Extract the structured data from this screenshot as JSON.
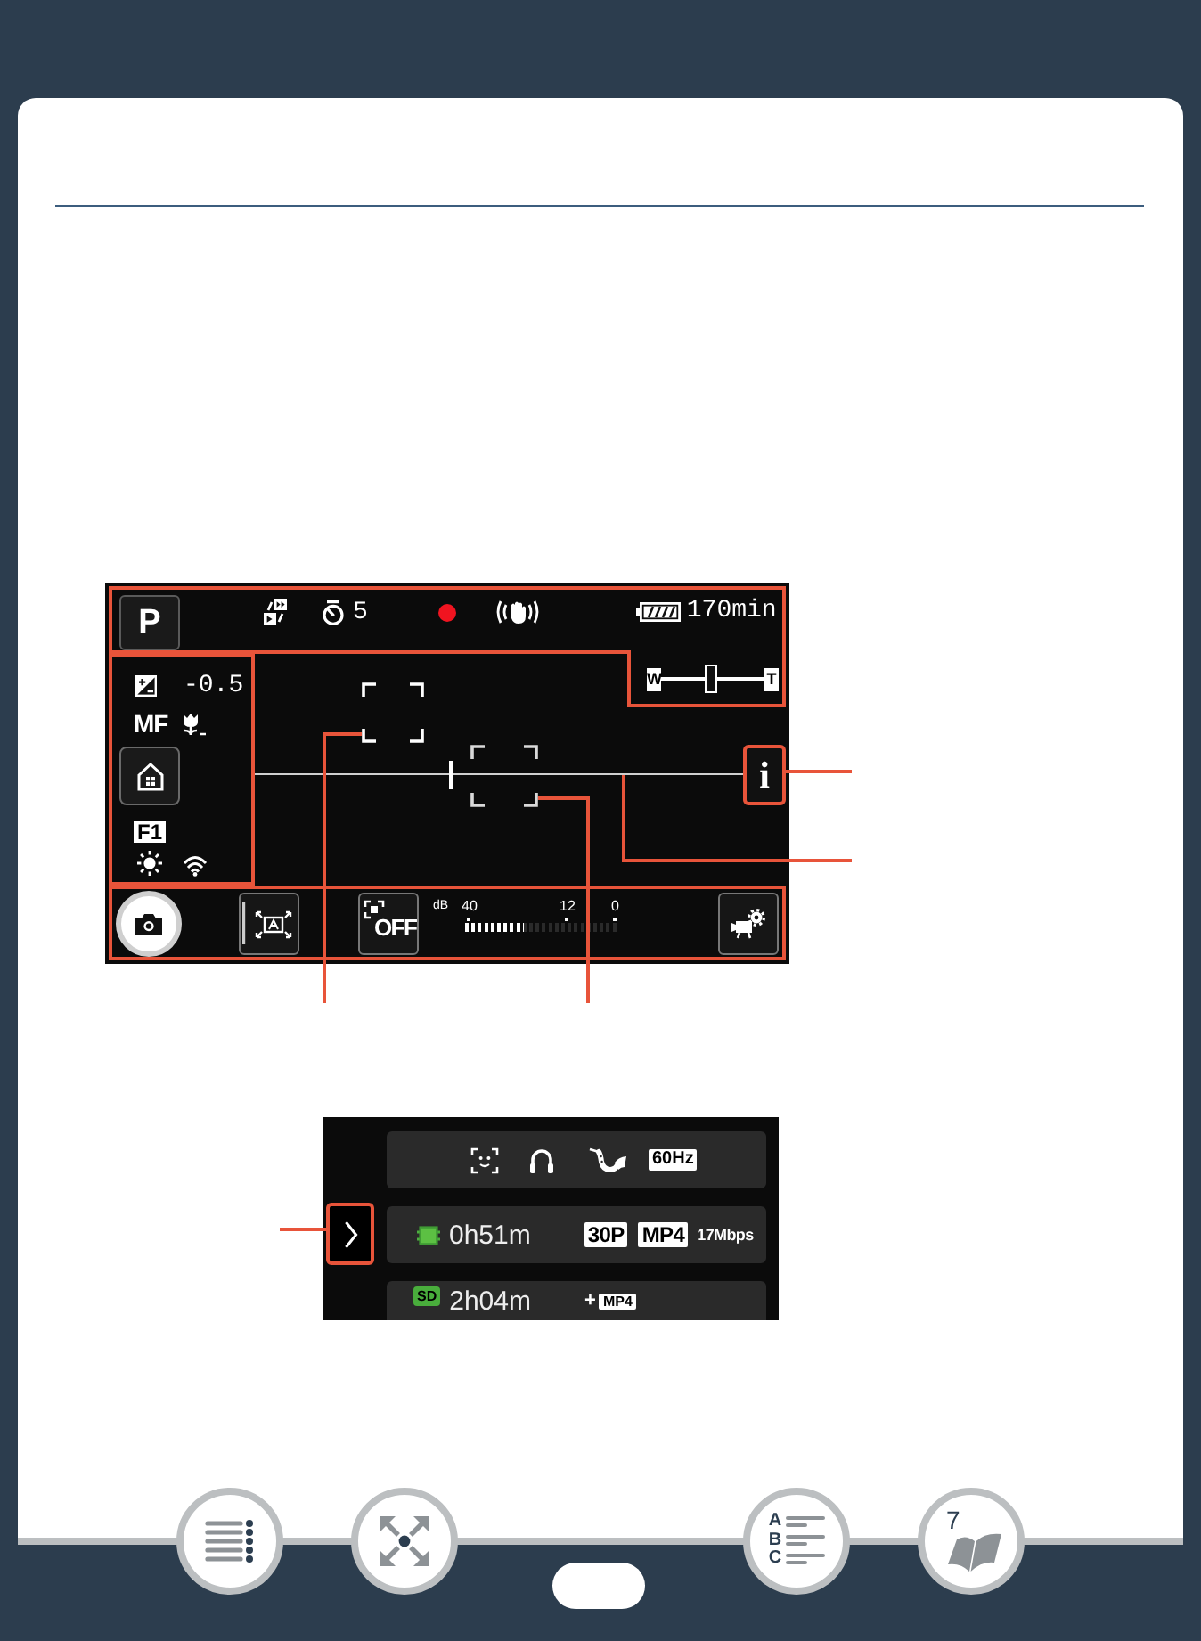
{
  "camera_screen": {
    "mode_button": "P",
    "self_timer": "5",
    "remaining_time": "170min",
    "zoom": {
      "wide": "W",
      "tele": "T",
      "level": 0.48
    },
    "exposure": "-0.5",
    "focus_mode": "MF",
    "custom_key": "F1",
    "info_button": "i",
    "off_button": "OFF",
    "audio_meter": {
      "unit": "dB",
      "ticks": [
        "40",
        "12",
        "0"
      ],
      "level": 0.38
    }
  },
  "info_screen": {
    "rows": [
      {
        "kind": "features",
        "badge": "60Hz"
      },
      {
        "kind": "storage",
        "storage": {
          "kind": "memory"
        },
        "time": "0h51m",
        "badges": [
          "30P",
          "MP4"
        ],
        "bitrate": "17Mbps"
      },
      {
        "kind": "storage",
        "storage": {
          "kind": "card",
          "label": "SD"
        },
        "time": "2h04m",
        "prefix": "+",
        "badges": [
          "MP4"
        ]
      }
    ]
  },
  "nav_buttons": [
    {
      "kind": "contents"
    },
    {
      "kind": "fit"
    },
    {
      "kind": "index",
      "letters": [
        "A",
        "B",
        "C"
      ]
    },
    {
      "kind": "page",
      "label": "7"
    }
  ]
}
